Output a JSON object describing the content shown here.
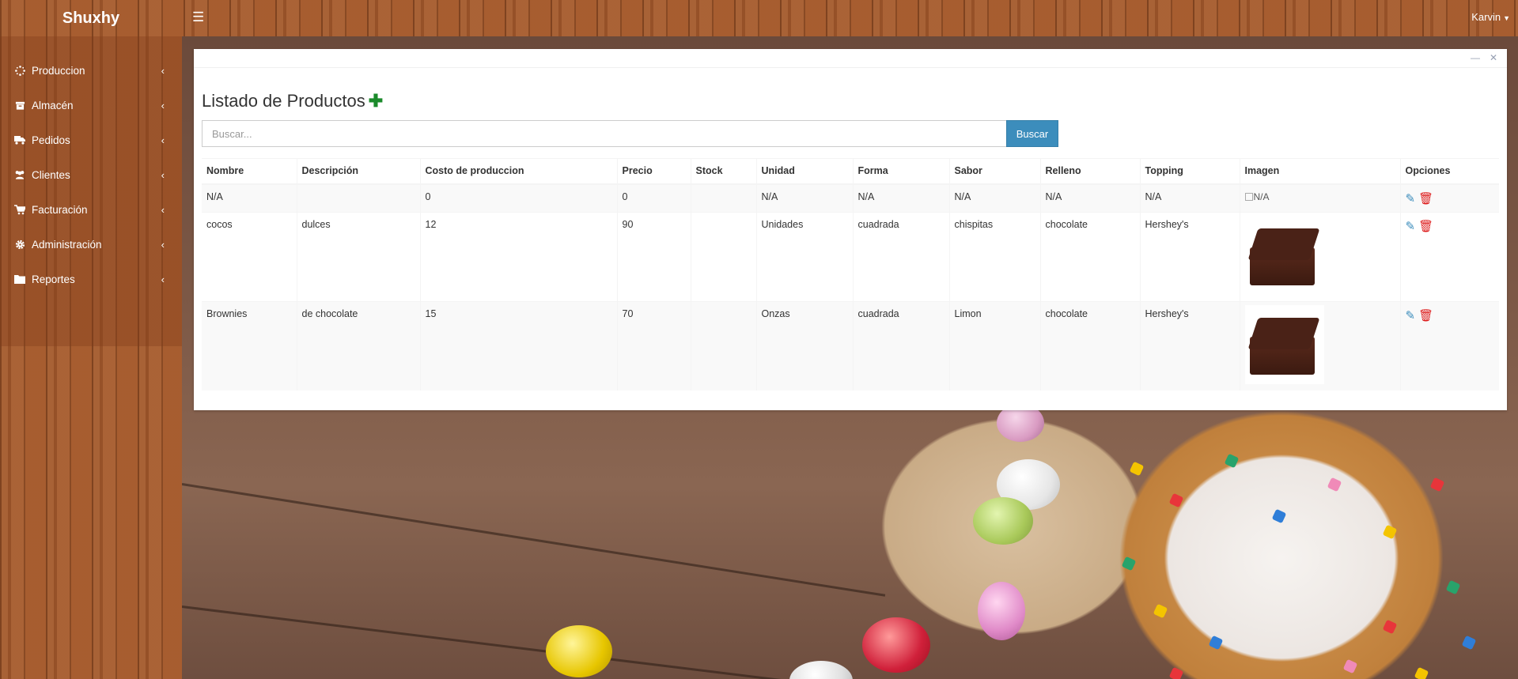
{
  "app": {
    "brand": "Shuxhy",
    "user": "Karvin"
  },
  "sidebar": {
    "items": [
      {
        "label": "Produccion",
        "icon": "spinner-icon"
      },
      {
        "label": "Almacén",
        "icon": "archive-icon"
      },
      {
        "label": "Pedidos",
        "icon": "truck-icon"
      },
      {
        "label": "Clientes",
        "icon": "users-icon"
      },
      {
        "label": "Facturación",
        "icon": "cart-icon"
      },
      {
        "label": "Administración",
        "icon": "gear-icon"
      },
      {
        "label": "Reportes",
        "icon": "folder-icon"
      }
    ]
  },
  "panel": {
    "title": "Listado de Productos",
    "search_placeholder": "Buscar...",
    "search_button": "Buscar"
  },
  "table": {
    "headers": [
      "Nombre",
      "Descripción",
      "Costo de produccion",
      "Precio",
      "Stock",
      "Unidad",
      "Forma",
      "Sabor",
      "Relleno",
      "Topping",
      "Imagen",
      "Opciones"
    ],
    "rows": [
      {
        "nombre": "N/A",
        "descripcion": "",
        "costo": "0",
        "precio": "0",
        "stock": "",
        "unidad": "N/A",
        "forma": "N/A",
        "sabor": "N/A",
        "relleno": "N/A",
        "topping": "N/A",
        "imagen_alt": "N/A"
      },
      {
        "nombre": "cocos",
        "descripcion": "dulces",
        "costo": "12",
        "precio": "90",
        "stock": "",
        "unidad": "Unidades",
        "forma": "cuadrada",
        "sabor": "chispitas",
        "relleno": "chocolate",
        "topping": "Hershey's",
        "imagen_alt": ""
      },
      {
        "nombre": "Brownies",
        "descripcion": "de chocolate",
        "costo": "15",
        "precio": "70",
        "stock": "",
        "unidad": "Onzas",
        "forma": "cuadrada",
        "sabor": "Limon",
        "relleno": "chocolate",
        "topping": "Hershey's",
        "imagen_alt": ""
      }
    ]
  },
  "colors": {
    "primary": "#3c8dbc",
    "add": "#1b8a2b",
    "delete": "#dd1b1b"
  }
}
